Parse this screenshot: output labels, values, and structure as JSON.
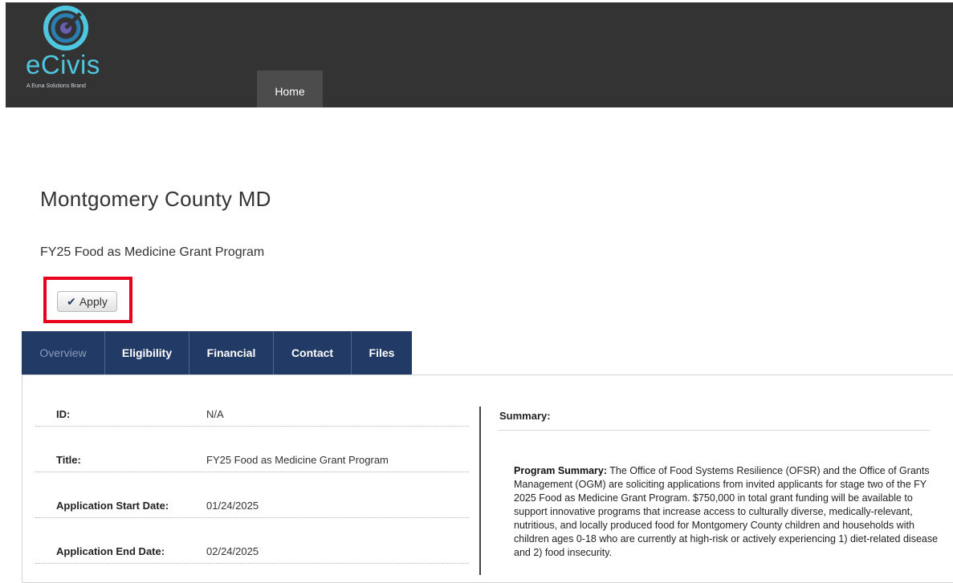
{
  "header": {
    "logo_text": "eCivis",
    "logo_tagline": "A Euna Solutions Brand",
    "nav_home": "Home",
    "colors": {
      "bar": "#333333",
      "logo": "#4ec6e0",
      "nav_active": "#4c4c4c"
    }
  },
  "page": {
    "org_name": "Montgomery County MD",
    "program_name": "FY25 Food as Medicine Grant Program",
    "apply_label": "Apply",
    "apply_icon": "check-icon"
  },
  "tabs": [
    {
      "label": "Overview"
    },
    {
      "label": "Eligibility"
    },
    {
      "label": "Financial"
    },
    {
      "label": "Contact"
    },
    {
      "label": "Files"
    }
  ],
  "overview": {
    "fields": [
      {
        "label": "ID:",
        "value": "N/A"
      },
      {
        "label": "Title:",
        "value": "FY25 Food as Medicine Grant Program"
      },
      {
        "label": "Application Start Date:",
        "value": "01/24/2025"
      },
      {
        "label": "Application End Date:",
        "value": "02/24/2025"
      }
    ],
    "summary_label": "Summary:",
    "summary_heading": "Program Summary:",
    "summary_body": " The Office of Food Systems Resilience (OFSR) and the Office of Grants Management (OGM) are soliciting applications from invited applicants for stage two of the FY 2025 Food as Medicine Grant Program. $750,000 in total grant funding will be available to support innovative programs that increase access to culturally diverse, medically-relevant, nutritious, and locally produced food for Montgomery County children and households with children ages 0-18 who are currently at high-risk or actively experiencing 1) diet-related disease and 2) food insecurity."
  },
  "colors": {
    "tab_bar": "#213a66",
    "highlight": "#e8001c"
  }
}
